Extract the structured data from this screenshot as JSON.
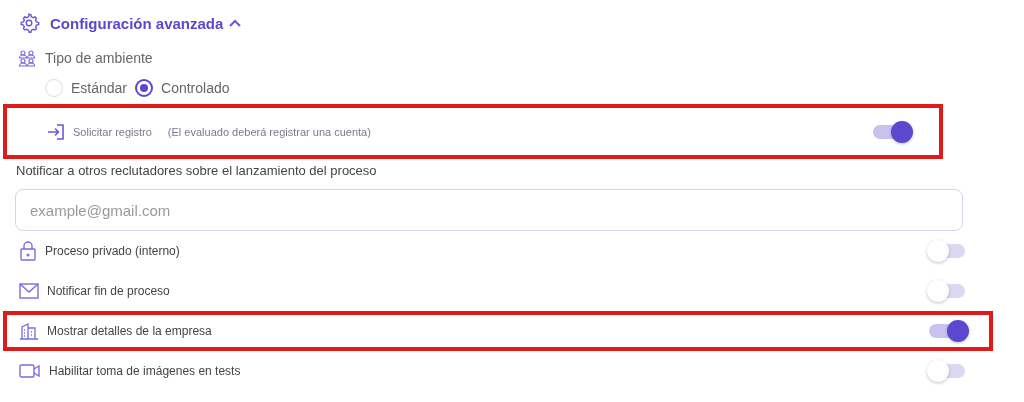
{
  "section": {
    "title": "Configuración avanzada",
    "expanded": true
  },
  "environment": {
    "label": "Tipo de ambiente",
    "options": [
      {
        "label": "Estándar",
        "selected": false
      },
      {
        "label": "Controlado",
        "selected": true
      }
    ]
  },
  "registration": {
    "label": "Solicitar registro",
    "hint": "(El evaluado deberá registrar una cuenta)",
    "on": true,
    "highlighted": true
  },
  "notify": {
    "label": "Notificar a otros reclutadores sobre el lanzamiento del proceso",
    "placeholder": "example@gmail.com"
  },
  "options": [
    {
      "kind": "lock",
      "label": "Proceso privado (interno)",
      "on": false,
      "highlighted": false
    },
    {
      "kind": "mail",
      "label": "Notificar fin de proceso",
      "on": false,
      "highlighted": false
    },
    {
      "kind": "building",
      "label": "Mostrar detalles de la empresa",
      "on": true,
      "highlighted": true
    },
    {
      "kind": "video",
      "label": "Habilitar toma de imágenes en tests",
      "on": false,
      "highlighted": false
    }
  ]
}
